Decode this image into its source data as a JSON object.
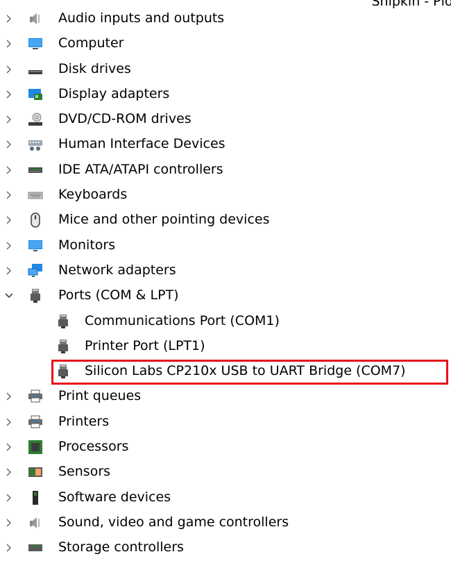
{
  "corner_text": "Snipkin - Plot",
  "device_tree": {
    "categories": [
      {
        "label": "Audio inputs and outputs",
        "icon": "speaker-icon",
        "expanded": false
      },
      {
        "label": "Computer",
        "icon": "computer-icon",
        "expanded": false
      },
      {
        "label": "Disk drives",
        "icon": "disk-drive-icon",
        "expanded": false
      },
      {
        "label": "Display adapters",
        "icon": "display-adapter-icon",
        "expanded": false
      },
      {
        "label": "DVD/CD-ROM drives",
        "icon": "dvd-drive-icon",
        "expanded": false
      },
      {
        "label": "Human Interface Devices",
        "icon": "hid-icon",
        "expanded": false
      },
      {
        "label": "IDE ATA/ATAPI controllers",
        "icon": "ide-controller-icon",
        "expanded": false
      },
      {
        "label": "Keyboards",
        "icon": "keyboard-icon",
        "expanded": false
      },
      {
        "label": "Mice and other pointing devices",
        "icon": "mouse-icon",
        "expanded": false
      },
      {
        "label": "Monitors",
        "icon": "monitor-icon",
        "expanded": false
      },
      {
        "label": "Network adapters",
        "icon": "network-adapter-icon",
        "expanded": false
      },
      {
        "label": "Ports (COM & LPT)",
        "icon": "port-icon",
        "expanded": true
      },
      {
        "label": "Print queues",
        "icon": "printer-icon",
        "expanded": false
      },
      {
        "label": "Printers",
        "icon": "printer-icon",
        "expanded": false
      },
      {
        "label": "Processors",
        "icon": "processor-icon",
        "expanded": false
      },
      {
        "label": "Sensors",
        "icon": "sensor-icon",
        "expanded": false
      },
      {
        "label": "Software devices",
        "icon": "software-device-icon",
        "expanded": false
      },
      {
        "label": "Sound, video and game controllers",
        "icon": "speaker-icon",
        "expanded": false
      },
      {
        "label": "Storage controllers",
        "icon": "storage-controller-icon",
        "expanded": false
      }
    ],
    "ports_children": [
      {
        "label": "Communications Port (COM1)",
        "icon": "port-icon"
      },
      {
        "label": "Printer Port (LPT1)",
        "icon": "port-icon"
      },
      {
        "label": "Silicon Labs CP210x USB to UART Bridge (COM7)",
        "icon": "port-icon",
        "highlighted": true
      }
    ]
  },
  "colors": {
    "highlight_border": "#e8101a",
    "chevron": "#6b6b6b",
    "monitor_blue": "#1e88e5"
  }
}
